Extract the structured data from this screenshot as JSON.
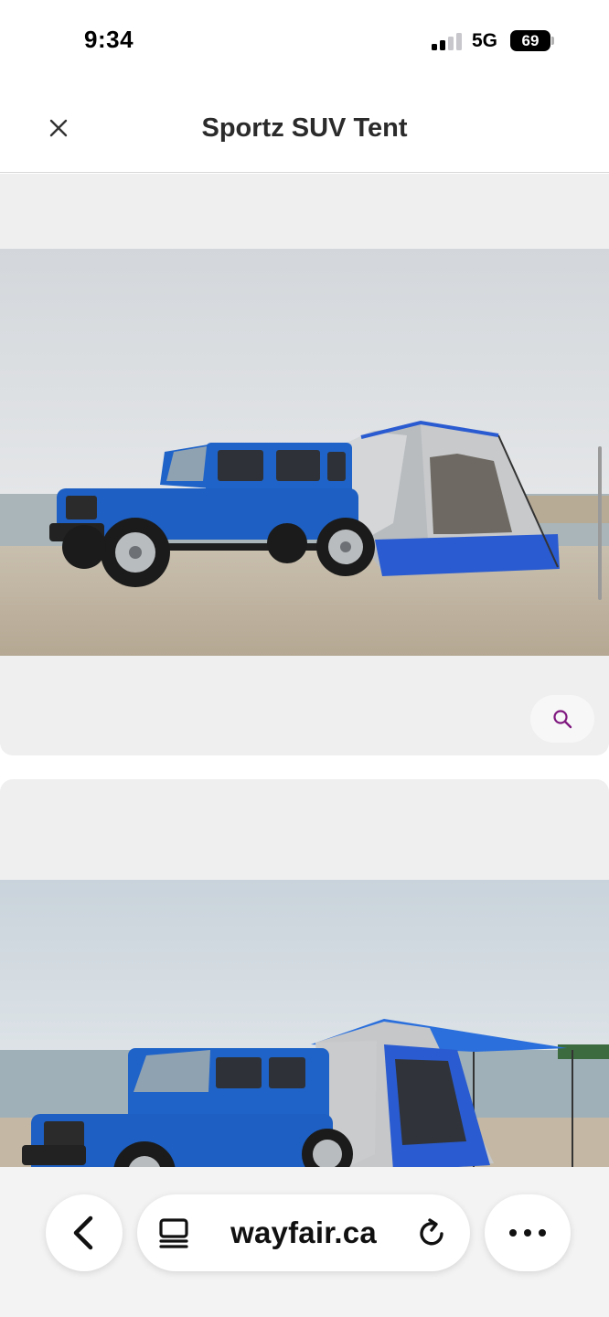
{
  "status_bar": {
    "time": "9:34",
    "network": "5G",
    "battery": "69"
  },
  "header": {
    "title": "Sportz SUV Tent",
    "close_icon": "close-icon"
  },
  "gallery": {
    "images": [
      {
        "icon": "photo-suv-tent-side"
      },
      {
        "icon": "photo-suv-tent-awning"
      }
    ],
    "zoom_icon": "search-icon"
  },
  "browser": {
    "url": "wayfair.ca",
    "back_icon": "chevron-left-icon",
    "tabs_icon": "tabs-icon",
    "reload_icon": "reload-icon",
    "more_icon": "more-icon"
  },
  "colors": {
    "accent": "#7f187f",
    "vehicle_blue": "#1f63c8",
    "tent_blue": "#2a5bd0",
    "tent_gray": "#bdbdbd"
  }
}
